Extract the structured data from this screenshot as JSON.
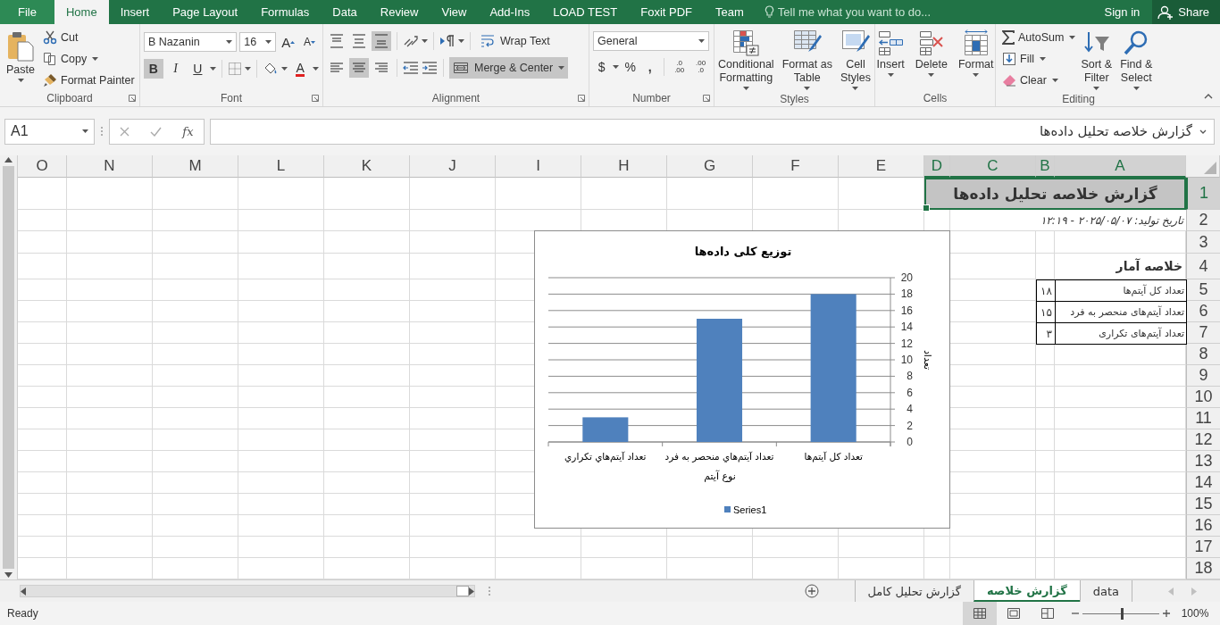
{
  "menu_tabs": [
    {
      "label": "File",
      "kind": "file",
      "selected": false
    },
    {
      "label": "Home",
      "kind": "tab",
      "selected": true
    },
    {
      "label": "Insert",
      "kind": "tab",
      "selected": false
    },
    {
      "label": "Page Layout",
      "kind": "tab",
      "selected": false
    },
    {
      "label": "Formulas",
      "kind": "tab",
      "selected": false
    },
    {
      "label": "Data",
      "kind": "tab",
      "selected": false
    },
    {
      "label": "Review",
      "kind": "tab",
      "selected": false
    },
    {
      "label": "View",
      "kind": "tab",
      "selected": false
    },
    {
      "label": "Add-Ins",
      "kind": "tab",
      "selected": false
    },
    {
      "label": "LOAD TEST",
      "kind": "tab",
      "selected": false
    },
    {
      "label": "Foxit PDF",
      "kind": "tab",
      "selected": false
    },
    {
      "label": "Team",
      "kind": "tab",
      "selected": false
    }
  ],
  "tell_me": {
    "placeholder": "Tell me what you want to do..."
  },
  "sign_in": "Sign in",
  "share": "Share",
  "ribbon": {
    "clipboard": {
      "label": "Clipboard",
      "paste": "Paste",
      "cut": "Cut",
      "copy": "Copy",
      "format_painter": "Format Painter"
    },
    "font": {
      "label": "Font",
      "font_name": "B Nazanin",
      "font_size": "16",
      "grow": "A",
      "shrink": "A",
      "bold": {
        "label": "B",
        "selected": true
      },
      "italic": {
        "label": "I",
        "selected": false
      },
      "underline": {
        "label": "U",
        "selected": false
      },
      "font_color": "A"
    },
    "alignment": {
      "label": "Alignment",
      "top_align": false,
      "middle_align": false,
      "bottom_align": true,
      "left_align": false,
      "center_align": true,
      "right_align": false,
      "wrap_text": "Wrap Text",
      "merge_center": {
        "label": "Merge & Center",
        "selected": true
      }
    },
    "number": {
      "label": "Number",
      "format": "General",
      "currency": "$",
      "percent": "%",
      "comma": ",",
      "increase_decimal": {
        "top": ".0",
        "bottom": ".00"
      },
      "decrease_decimal": {
        "top": ".00",
        "bottom": ".0"
      }
    },
    "styles": {
      "label": "Styles",
      "conditional_formatting": "Conditional\nFormatting",
      "format_as_table": "Format as\nTable",
      "cell_styles": "Cell\nStyles"
    },
    "cells": {
      "label": "Cells",
      "insert": "Insert",
      "delete": "Delete",
      "format": "Format"
    },
    "editing": {
      "label": "Editing",
      "autosum": "AutoSum",
      "fill": "Fill",
      "clear": "Clear",
      "sort_filter": "Sort &\nFilter",
      "find_select": "Find &\nSelect"
    }
  },
  "formula_bar": {
    "name_box": "A1",
    "fx": "fx",
    "formula": "گزارش خلاصه تحلیل داده‌ها"
  },
  "sheet": {
    "columns": [
      {
        "label": "O",
        "selected": false
      },
      {
        "label": "N",
        "selected": false
      },
      {
        "label": "M",
        "selected": false
      },
      {
        "label": "L",
        "selected": false
      },
      {
        "label": "K",
        "selected": false
      },
      {
        "label": "J",
        "selected": false
      },
      {
        "label": "I",
        "selected": false
      },
      {
        "label": "H",
        "selected": false
      },
      {
        "label": "G",
        "selected": false
      },
      {
        "label": "F",
        "selected": false
      },
      {
        "label": "E",
        "selected": false
      },
      {
        "label": "D",
        "selected": true
      },
      {
        "label": "C",
        "selected": true
      },
      {
        "label": "B",
        "selected": true
      },
      {
        "label": "A",
        "selected": true
      }
    ],
    "rows": [
      {
        "label": "1",
        "selected": true
      },
      {
        "label": "2",
        "selected": false
      },
      {
        "label": "3",
        "selected": false
      },
      {
        "label": "4",
        "selected": false
      },
      {
        "label": "5",
        "selected": false
      },
      {
        "label": "6",
        "selected": false
      },
      {
        "label": "7",
        "selected": false
      },
      {
        "label": "8",
        "selected": false
      },
      {
        "label": "9",
        "selected": false
      },
      {
        "label": "10",
        "selected": false
      },
      {
        "label": "11",
        "selected": false
      },
      {
        "label": "12",
        "selected": false
      },
      {
        "label": "13",
        "selected": false
      },
      {
        "label": "14",
        "selected": false
      },
      {
        "label": "15",
        "selected": false
      },
      {
        "label": "16",
        "selected": false
      },
      {
        "label": "17",
        "selected": false
      },
      {
        "label": "18",
        "selected": false
      }
    ],
    "title": "گزارش خلاصه تحلیل داده‌ها",
    "date_line": "تاریخ تولید: ۲۰۲۵/۰۵/۰۷ - ۱۲:۱۹",
    "summary_heading": "خلاصه آمار",
    "summary_rows": [
      {
        "label": "تعداد کل آیتم‌ها",
        "value": "۱۸"
      },
      {
        "label": "تعداد آیتم‌های منحصر به فرد",
        "value": "۱۵"
      },
      {
        "label": "تعداد آیتم‌های تکراری",
        "value": "۳"
      }
    ],
    "chart": {
      "chart_data": {
        "type": "bar",
        "title": "توزیع کلی داده‌ها",
        "xlabel": "نوع آیتم",
        "ylabel": "تعداد",
        "categories": [
          "تعداد آیتم‌هاي تکراري",
          "تعداد آیتم‌هاي منحصر به فرد",
          "تعداد کل آیتم‌ها"
        ],
        "series": [
          {
            "name": "Series1",
            "color": "#4f81bd",
            "values": [
              3,
              15,
              18
            ]
          }
        ],
        "ylim": [
          0,
          20
        ],
        "yticks": [
          0,
          2,
          4,
          6,
          8,
          10,
          12,
          14,
          16,
          18,
          20
        ],
        "grid": true,
        "orientation": "vertical"
      }
    }
  },
  "sheet_tabs": [
    {
      "label": "data",
      "selected": false
    },
    {
      "label": "گزارش خلاصه",
      "selected": true
    },
    {
      "label": "گزارش تحلیل کامل",
      "selected": false
    }
  ],
  "status_bar": {
    "status": "Ready",
    "zoom": "100%",
    "zoom_slider": {
      "level": 0.5
    }
  }
}
